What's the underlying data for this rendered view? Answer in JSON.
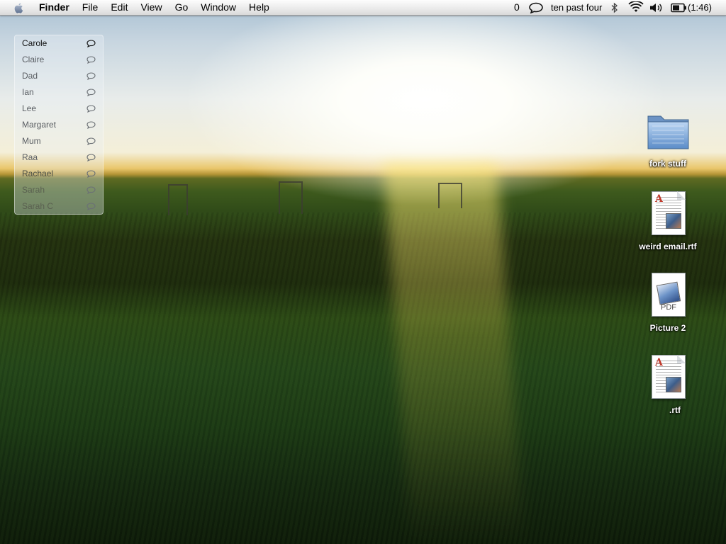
{
  "menubar": {
    "apple_icon": "apple-icon",
    "menus": [
      "Finder",
      "File",
      "Edit",
      "View",
      "Go",
      "Window",
      "Help"
    ],
    "status": {
      "unread_count": "0",
      "chat_icon": "speech-bubble-icon",
      "clock_text": "ten past four",
      "bluetooth_icon": "bluetooth-icon",
      "wifi_icon": "wifi-icon",
      "volume_icon": "volume-icon",
      "battery_icon": "battery-icon",
      "battery_text": "(1:46)"
    }
  },
  "buddy_list": {
    "buddies": [
      {
        "name": "Carole",
        "active": true
      },
      {
        "name": "Claire",
        "active": false
      },
      {
        "name": "Dad",
        "active": false
      },
      {
        "name": "Ian",
        "active": false
      },
      {
        "name": "Lee",
        "active": false
      },
      {
        "name": "Margaret",
        "active": false
      },
      {
        "name": "Mum",
        "active": false
      },
      {
        "name": "Raa",
        "active": false
      },
      {
        "name": "Rachael",
        "active": false
      },
      {
        "name": "Sarah",
        "active": false
      },
      {
        "name": "Sarah C",
        "active": false
      }
    ]
  },
  "desktop_icons": [
    {
      "label": "fork stuff",
      "kind": "folder"
    },
    {
      "label": "weird email.rtf",
      "kind": "rtf"
    },
    {
      "label": "Picture 2",
      "kind": "pdf",
      "badge": "PDF"
    },
    {
      "label": ".rtf",
      "kind": "rtf"
    }
  ]
}
